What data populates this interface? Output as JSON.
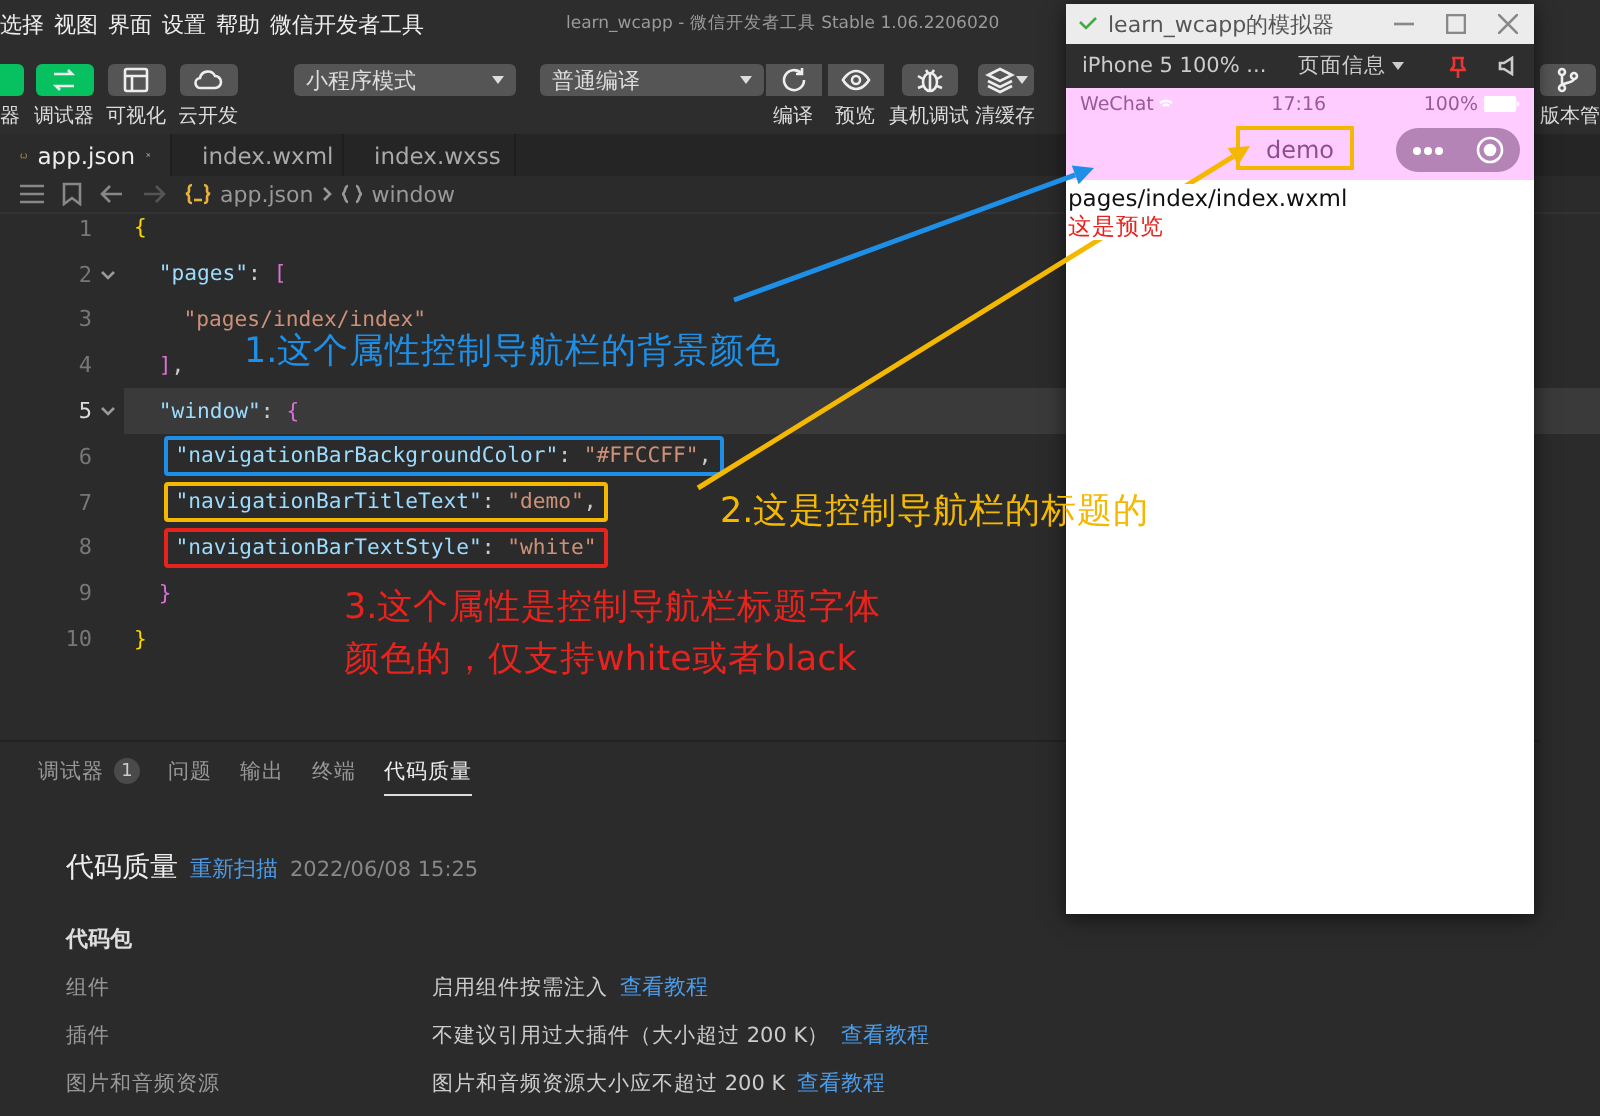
{
  "menu_bar": {
    "items": [
      "选择",
      "视图",
      "界面",
      "设置",
      "帮助",
      "微信开发者工具"
    ],
    "title": "learn_wcapp - 微信开发者工具 Stable 1.06.2206020"
  },
  "toolbar": {
    "buttons": [
      {
        "label": "器",
        "kind": "simulator",
        "active": true
      },
      {
        "label": "调试器",
        "kind": "debugger",
        "active": true
      },
      {
        "label": "可视化",
        "kind": "layout",
        "active": false
      },
      {
        "label": "云开发",
        "kind": "cloud",
        "active": false
      }
    ],
    "mode_select": "小程序模式",
    "compile_select": "普通编译",
    "actions": [
      {
        "label": "编译",
        "kind": "refresh"
      },
      {
        "label": "预览",
        "kind": "eye"
      },
      {
        "label": "真机调试",
        "kind": "bug"
      },
      {
        "label": "清缓存",
        "kind": "layers"
      }
    ],
    "version_label": "版本管"
  },
  "editor_tabs": [
    {
      "label": "app.json",
      "kind": "json",
      "selected": true
    },
    {
      "label": "index.wxml",
      "kind": "wxml",
      "selected": false
    },
    {
      "label": "index.wxss",
      "kind": "wxss",
      "selected": false
    }
  ],
  "breadcrumb": {
    "file": "app.json",
    "symbol": "window"
  },
  "code_lines": [
    {
      "number": "1",
      "foldable": false,
      "current": false,
      "tokens": [
        {
          "kind": "brace",
          "text": "{"
        }
      ]
    },
    {
      "number": "2",
      "foldable": true,
      "current": false,
      "tokens": [
        {
          "kind": "key",
          "text": "  \"pages\""
        },
        {
          "kind": "punct",
          "text": ": "
        },
        {
          "kind": "bracket",
          "text": "["
        }
      ]
    },
    {
      "number": "3",
      "foldable": false,
      "current": false,
      "tokens": [
        {
          "kind": "string",
          "text": "    \"pages/index/index\""
        }
      ]
    },
    {
      "number": "4",
      "foldable": false,
      "current": false,
      "tokens": [
        {
          "kind": "bracket",
          "text": "  ]"
        },
        {
          "kind": "punct",
          "text": ","
        }
      ]
    },
    {
      "number": "5",
      "foldable": true,
      "current": true,
      "tokens": [
        {
          "kind": "key",
          "text": "  \"window\""
        },
        {
          "kind": "punct",
          "text": ": "
        },
        {
          "kind": "bracket",
          "text": "{"
        }
      ]
    },
    {
      "number": "6",
      "foldable": false,
      "current": false,
      "color": "#1e8fe6",
      "tokens": [
        {
          "kind": "key",
          "text": "    \"navigationBarBackgroundColor\""
        },
        {
          "kind": "punct",
          "text": ": "
        },
        {
          "kind": "string",
          "text": "\"#FFCCFF\""
        },
        {
          "kind": "punct",
          "text": ","
        }
      ]
    },
    {
      "number": "7",
      "foldable": false,
      "current": false,
      "color": "#f5b800",
      "tokens": [
        {
          "kind": "key",
          "text": "    \"navigationBarTitleText\""
        },
        {
          "kind": "punct",
          "text": ": "
        },
        {
          "kind": "string",
          "text": "\"demo\""
        },
        {
          "kind": "punct",
          "text": ","
        }
      ]
    },
    {
      "number": "8",
      "foldable": false,
      "current": false,
      "color": "#e8231d",
      "tokens": [
        {
          "kind": "key",
          "text": "    \"navigationBarTextStyle\""
        },
        {
          "kind": "punct",
          "text": ": "
        },
        {
          "kind": "string",
          "text": "\"white\""
        }
      ]
    },
    {
      "number": "9",
      "foldable": false,
      "current": false,
      "tokens": [
        {
          "kind": "bracket",
          "text": "  }"
        }
      ]
    },
    {
      "number": "10",
      "foldable": false,
      "current": false,
      "tokens": [
        {
          "kind": "brace",
          "text": "}"
        }
      ]
    }
  ],
  "annotations": [
    {
      "text": "1.这个属性控制导航栏的背景颜色",
      "color": "#1e8fe6"
    },
    {
      "text": "2.这是控制导航栏的标题的",
      "color": "#f5b800"
    },
    {
      "text": "3.这个属性是控制导航栏标题字体颜色的，仅支持white或者black",
      "color": "#e8231d"
    }
  ],
  "bottom_tabs": [
    {
      "label": "调试器",
      "badge": "1",
      "selected": false
    },
    {
      "label": "问题",
      "selected": false
    },
    {
      "label": "输出",
      "selected": false
    },
    {
      "label": "终端",
      "selected": false
    },
    {
      "label": "代码质量",
      "selected": true
    }
  ],
  "code_quality": {
    "title": "代码质量",
    "rescan": "重新扫描",
    "time": "2022/06/08 15:25",
    "section": "代码包",
    "rows": [
      {
        "name": "组件",
        "message": "启用组件按需注入",
        "link": "查看教程"
      },
      {
        "name": "插件",
        "message": "不建议引用过大插件（大小超过 200 K）",
        "link": "查看教程"
      },
      {
        "name": "图片和音频资源",
        "message": "图片和音频资源大小应不超过 200 K",
        "link": "查看教程"
      }
    ]
  },
  "simulator": {
    "title": "learn_wcapp的模拟器",
    "device": "iPhone 5 100% ...",
    "page_info": "页面信息",
    "status": {
      "carrier": "WeChat",
      "time": "17:16",
      "battery": "100%"
    },
    "nav_title": "demo",
    "content": [
      {
        "text": "pages/index/index.wxml",
        "color": "#111111"
      },
      {
        "text": "这是预览",
        "color": "#e8231d"
      }
    ]
  }
}
